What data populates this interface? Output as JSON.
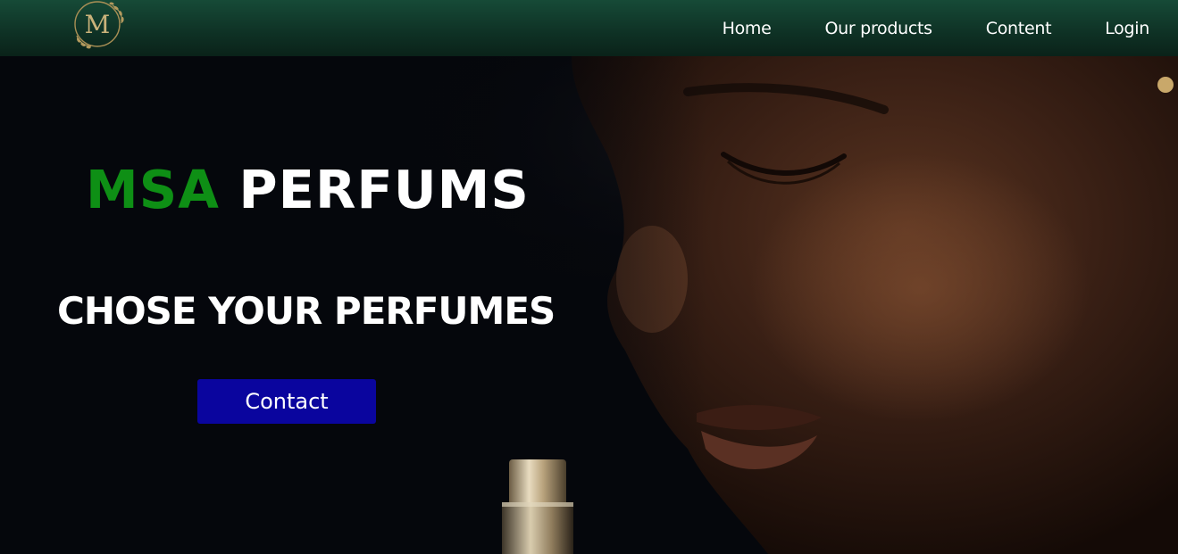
{
  "brand": {
    "logo_letter": "M"
  },
  "nav": {
    "items": [
      {
        "label": "Home"
      },
      {
        "label": "Our products"
      },
      {
        "label": "Content"
      },
      {
        "label": "Login"
      }
    ]
  },
  "hero": {
    "title_accent": "MSA",
    "title_rest": " PERFUMS",
    "subtitle": "CHOSE YOUR PERFUMES",
    "contact_label": "Contact"
  },
  "colors": {
    "navbar": "#134230",
    "title_accent": "#0e8f15",
    "button": "#0a059e",
    "logo_gold": "#b39a5e"
  }
}
